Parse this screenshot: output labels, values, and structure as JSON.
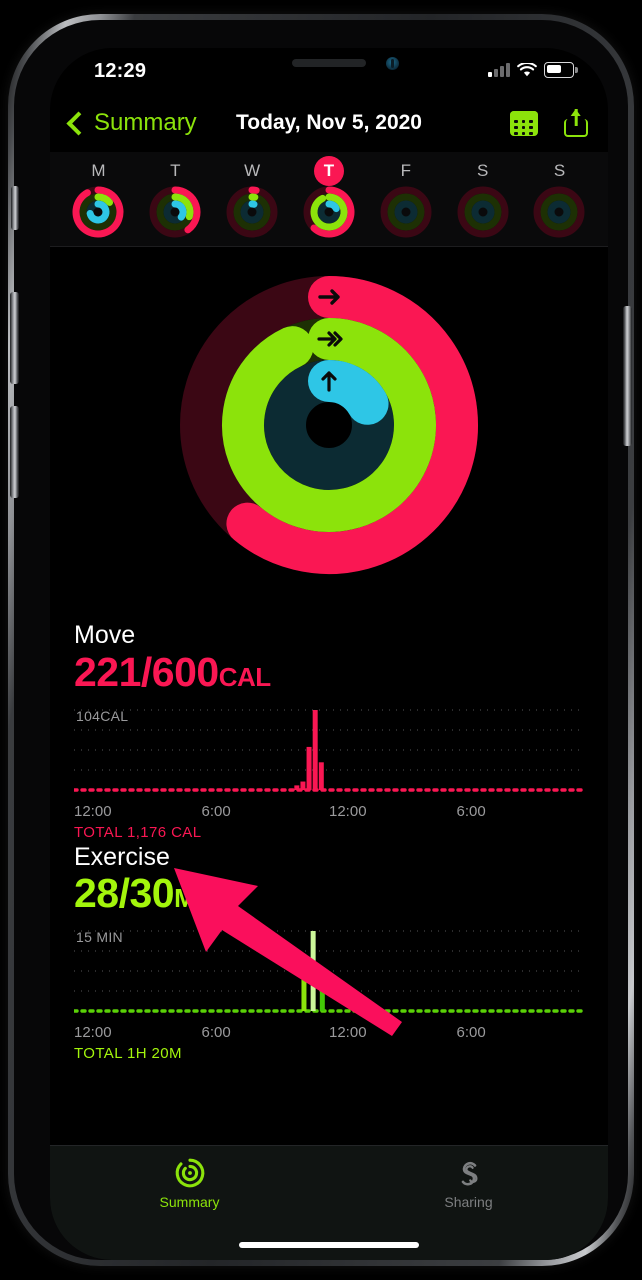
{
  "status_bar": {
    "time": "12:29",
    "signal_icon": "cellular-bars-icon",
    "wifi_icon": "wifi-icon",
    "battery_icon": "battery-icon"
  },
  "nav": {
    "back_label": "Summary",
    "back_icon": "chevron-left-icon",
    "title": "Today, Nov 5, 2020",
    "calendar_icon": "calendar-icon",
    "share_icon": "share-icon"
  },
  "week": {
    "days": [
      {
        "letter": "M",
        "is_today": false,
        "move_pct": 92,
        "exercise_pct": 14,
        "stand_pct": 72
      },
      {
        "letter": "T",
        "is_today": false,
        "move_pct": 40,
        "exercise_pct": 30,
        "stand_pct": 36
      },
      {
        "letter": "W",
        "is_today": false,
        "move_pct": 3,
        "exercise_pct": 3,
        "stand_pct": 4
      },
      {
        "letter": "T",
        "is_today": true,
        "move_pct": 62,
        "exercise_pct": 93,
        "stand_pct": 18
      },
      {
        "letter": "F",
        "is_today": false,
        "move_pct": 0,
        "exercise_pct": 0,
        "stand_pct": 0
      },
      {
        "letter": "S",
        "is_today": false,
        "move_pct": 0,
        "exercise_pct": 0,
        "stand_pct": 0
      },
      {
        "letter": "S",
        "is_today": false,
        "move_pct": 0,
        "exercise_pct": 0,
        "stand_pct": 0
      }
    ]
  },
  "rings": {
    "move_pct": 61,
    "exercise_pct": 93,
    "stand_pct": 17,
    "move_icon": "arrow-right-icon",
    "exercise_icon": "double-chevron-right-icon",
    "stand_icon": "arrow-up-icon",
    "colors": {
      "move": "#fa1753",
      "move_track": "#3b0714",
      "exercise": "#8ce30b",
      "exercise_track": "#1d3004",
      "stand": "#2ec6e6",
      "stand_track": "#0c2b33"
    }
  },
  "move": {
    "title": "Move",
    "value": "221/600",
    "unit": "CAL",
    "total": "TOTAL 1,176 CAL",
    "color": "#fa1753"
  },
  "exercise": {
    "title": "Exercise",
    "value": "28/30",
    "unit": "MIN",
    "total": "TOTAL 1H 20M",
    "color": "#a3f50c"
  },
  "tabs": [
    {
      "label": "Summary",
      "icon": "activity-rings-icon",
      "active": true
    },
    {
      "label": "Sharing",
      "icon": "sharing-s-icon",
      "active": false
    }
  ],
  "annotation": {
    "type": "arrow",
    "color": "#fa0f5c",
    "points_to": "move-total-label"
  },
  "chart_data": [
    {
      "type": "bar",
      "name": "move-chart",
      "title": "Move",
      "ylabel": "104CAL",
      "ymax": 104,
      "ylim": [
        0,
        104
      ],
      "grid": true,
      "color": "#fa1753",
      "xlabel": "",
      "tick_labels": [
        "12:00",
        "6:00",
        "12:00",
        "6:00"
      ],
      "tick_positions_pct": [
        0,
        25,
        50,
        75
      ],
      "total_label": "TOTAL 1,176 CAL",
      "bars": [
        {
          "x_pct": 43.2,
          "value": 6
        },
        {
          "x_pct": 44.4,
          "value": 11
        },
        {
          "x_pct": 45.6,
          "value": 56
        },
        {
          "x_pct": 46.8,
          "value": 104
        },
        {
          "x_pct": 48.0,
          "value": 36
        }
      ]
    },
    {
      "type": "bar",
      "name": "exercise-chart",
      "title": "Exercise",
      "ylabel": "15 MIN",
      "ymax": 15,
      "ylim": [
        0,
        15
      ],
      "grid": true,
      "color": "#5ad107",
      "xlabel": "",
      "tick_labels": [
        "12:00",
        "6:00",
        "12:00",
        "6:00"
      ],
      "tick_positions_pct": [
        0,
        25,
        50,
        75
      ],
      "total_label": "TOTAL 1H 20M",
      "bars": [
        {
          "x_pct": 44.6,
          "value": 8.3,
          "color": "#8ce30b"
        },
        {
          "x_pct": 46.4,
          "value": 15.0,
          "color": "#ccf79a"
        },
        {
          "x_pct": 48.2,
          "value": 5.0,
          "color": "#43c906"
        }
      ]
    }
  ]
}
